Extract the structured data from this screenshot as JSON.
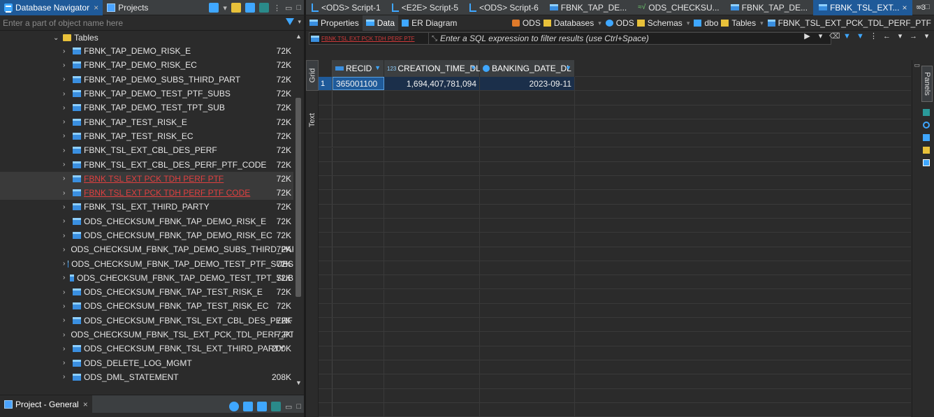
{
  "left": {
    "tabs": [
      {
        "label": "Database Navigator"
      },
      {
        "label": "Projects"
      }
    ],
    "search": {
      "placeholder": "Enter a part of object name here",
      "value": ""
    },
    "folder": {
      "label": "Tables"
    },
    "items": [
      {
        "name": "FBNK_TAP_DEMO_RISK_E",
        "size": "72K"
      },
      {
        "name": "FBNK_TAP_DEMO_RISK_EC",
        "size": "72K"
      },
      {
        "name": "FBNK_TAP_DEMO_SUBS_THIRD_PART",
        "size": "72K"
      },
      {
        "name": "FBNK_TAP_DEMO_TEST_PTF_SUBS",
        "size": "72K"
      },
      {
        "name": "FBNK_TAP_DEMO_TEST_TPT_SUB",
        "size": "72K"
      },
      {
        "name": "FBNK_TAP_TEST_RISK_E",
        "size": "72K"
      },
      {
        "name": "FBNK_TAP_TEST_RISK_EC",
        "size": "72K"
      },
      {
        "name": "FBNK_TSL_EXT_CBL_DES_PERF",
        "size": "72K"
      },
      {
        "name": "FBNK_TSL_EXT_CBL_DES_PERF_PTF_CODE",
        "size": "72K"
      },
      {
        "name": "FBNK TSL EXT PCK TDH PERF PTF",
        "size": "72K"
      },
      {
        "name": "FBNK TSL EXT PCK TDH PERF PTF CODE",
        "size": "72K"
      },
      {
        "name": "FBNK_TSL_EXT_THIRD_PARTY",
        "size": "72K"
      },
      {
        "name": "ODS_CHECKSUM_FBNK_TAP_DEMO_RISK_E",
        "size": "72K"
      },
      {
        "name": "ODS_CHECKSUM_FBNK_TAP_DEMO_RISK_EC",
        "size": "72K"
      },
      {
        "name": "ODS_CHECKSUM_FBNK_TAP_DEMO_SUBS_THIRD_PART",
        "size": "72K"
      },
      {
        "name": "ODS_CHECKSUM_FBNK_TAP_DEMO_TEST_PTF_SUBS",
        "size": "72K"
      },
      {
        "name": "ODS_CHECKSUM_FBNK_TAP_DEMO_TEST_TPT_SUB",
        "size": "72K"
      },
      {
        "name": "ODS_CHECKSUM_FBNK_TAP_TEST_RISK_E",
        "size": "72K"
      },
      {
        "name": "ODS_CHECKSUM_FBNK_TAP_TEST_RISK_EC",
        "size": "72K"
      },
      {
        "name": "ODS_CHECKSUM_FBNK_TSL_EXT_CBL_DES_PERF",
        "size": "72K"
      },
      {
        "name": "ODS_CHECKSUM_FBNK_TSL_EXT_PCK_TDL_PERF_PTF",
        "size": "72K"
      },
      {
        "name": "ODS_CHECKSUM_FBNK_TSL_EXT_THIRD_PARTY",
        "size": "200K"
      },
      {
        "name": "ODS_DELETE_LOG_MGMT",
        "size": ""
      },
      {
        "name": "ODS_DML_STATEMENT",
        "size": "208K"
      }
    ],
    "project_tab": {
      "label": "Project - General"
    }
  },
  "editor": {
    "tabs": [
      {
        "label": "<ODS> Script-1"
      },
      {
        "label": "<E2E> Script-5"
      },
      {
        "label": "<ODS> Script-6"
      },
      {
        "label": "FBNK_TAP_DE..."
      },
      {
        "label": "ODS_CHECKSU..."
      },
      {
        "label": "FBNK_TAP_DE..."
      },
      {
        "label": "FBNK_TSL_EXT..."
      }
    ],
    "more_tabs": "»3",
    "subtabs": [
      {
        "label": "Properties"
      },
      {
        "label": "Data"
      },
      {
        "label": "ER Diagram"
      }
    ],
    "breadcrumbs": [
      {
        "label": "ODS"
      },
      {
        "label": "Databases"
      },
      {
        "label": "ODS"
      },
      {
        "label": "Schemas"
      },
      {
        "label": "dbo"
      },
      {
        "label": "Tables"
      },
      {
        "label": "FBNK_TSL_EXT_PCK_TDL_PERF_PTF"
      }
    ],
    "filter": {
      "table_label": "FBNK TSL EXT PCK TDH PERF PTF",
      "placeholder": "Enter a SQL expression to filter results (use Ctrl+Space)"
    },
    "vtabs": [
      {
        "label": "Grid"
      },
      {
        "label": "Text"
      }
    ],
    "panels_label": "Panels",
    "columns": [
      {
        "label": "RECID"
      },
      {
        "label": "CREATION_TIME_DL",
        "type_tag": "123"
      },
      {
        "label": "BANKING_DATE_DL"
      }
    ],
    "rows": [
      {
        "num": "1",
        "cells": [
          "365001100",
          "1,694,407,781,094",
          "2023-09-11"
        ]
      }
    ]
  },
  "colors": {
    "accent": "#1f5a99",
    "error_text": "#e04040",
    "folder": "#e8c13a",
    "table_icon": "#3a8fe0"
  }
}
